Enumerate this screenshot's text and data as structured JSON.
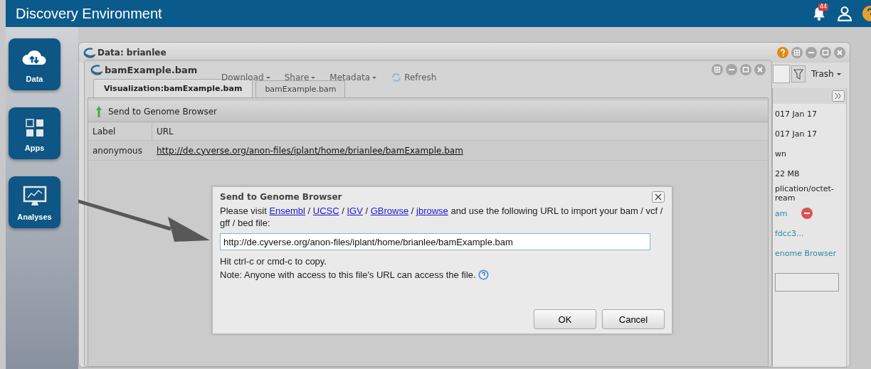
{
  "header": {
    "title": "Discovery Environment",
    "notification_count": "44"
  },
  "sidebar": {
    "items": [
      {
        "label": "Data",
        "kind": "cloud"
      },
      {
        "label": "Apps",
        "kind": "grid"
      },
      {
        "label": "Analyses",
        "kind": "monitor"
      }
    ]
  },
  "data_window": {
    "title": "Data: brianlee",
    "toolbar": [
      {
        "label": "Download",
        "kind": "menu"
      },
      {
        "label": "Share",
        "kind": "menu"
      },
      {
        "label": "Metadata",
        "kind": "menu"
      },
      {
        "label": "Refresh",
        "kind": "refresh"
      }
    ],
    "trash_label": "Trash",
    "details": [
      {
        "text": "017 Jan 17",
        "kind": "text"
      },
      {
        "text": "017 Jan 17",
        "kind": "text"
      },
      {
        "text": "wn",
        "kind": "text"
      },
      {
        "text": "22 MB",
        "kind": "text"
      },
      {
        "text": "plication/octet-ream",
        "kind": "text"
      },
      {
        "text": "am",
        "kind": "removable-link"
      },
      {
        "text": "fdcc3...",
        "kind": "link"
      },
      {
        "text": "enome Browser",
        "kind": "link"
      },
      {
        "kind": "field"
      }
    ]
  },
  "file_window": {
    "title": "bamExample.bam",
    "tabs": [
      {
        "label": "Visualization:bamExample.bam",
        "selected": true
      },
      {
        "label": "bamExample.bam",
        "selected": false
      }
    ],
    "action": "Send to Genome Browser",
    "table": {
      "columns": [
        "Label",
        "URL"
      ],
      "rows": [
        [
          "anonymous",
          "http://de.cyverse.org/anon-files/iplant/home/brianlee/bamExample.bam"
        ]
      ]
    }
  },
  "dialog": {
    "title": "Send to Genome Browser",
    "message": [
      {
        "text": "Please visit ",
        "kind": "text"
      },
      {
        "text": "Ensembl",
        "kind": "link"
      },
      {
        "text": " / ",
        "kind": "text"
      },
      {
        "text": "UCSC",
        "kind": "link"
      },
      {
        "text": " / ",
        "kind": "text"
      },
      {
        "text": "IGV",
        "kind": "link"
      },
      {
        "text": " / ",
        "kind": "text"
      },
      {
        "text": "GBrowse",
        "kind": "link"
      },
      {
        "text": " / ",
        "kind": "text"
      },
      {
        "text": "jbrowse",
        "kind": "link"
      },
      {
        "text": " and use the following URL to import your bam / vcf / gff / bed file:",
        "kind": "text"
      }
    ],
    "url_value": "http://de.cyverse.org/anon-files/iplant/home/brianlee/bamExample.bam",
    "hint": "Hit ctrl-c or cmd-c to copy.",
    "note": "Note: Anyone with access to this file's URL can access the file.",
    "buttons": [
      "OK",
      "Cancel"
    ]
  }
}
